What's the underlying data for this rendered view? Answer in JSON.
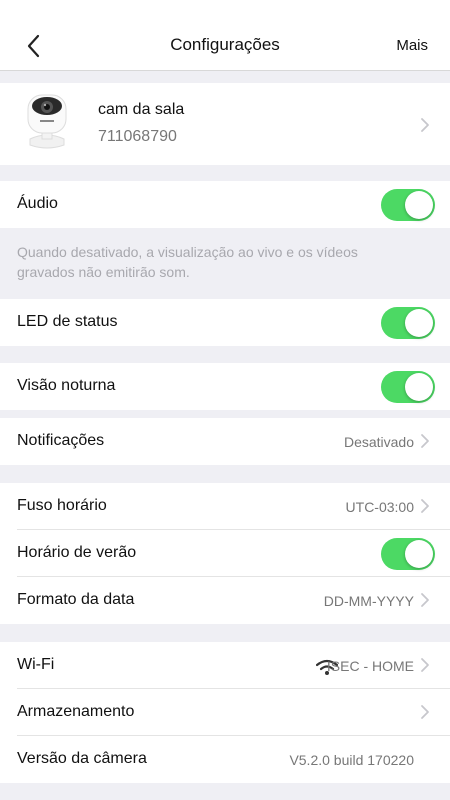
{
  "nav": {
    "title": "Configurações",
    "more_label": "Mais",
    "back_icon": "chevron-left-icon"
  },
  "device": {
    "name": "cam da sala",
    "serial": "711068790",
    "icon": "camera-icon"
  },
  "audio": {
    "label": "Áudio",
    "enabled": true,
    "note": "Quando desativado, a visualização ao vivo e os vídeos gravados não emitirão som."
  },
  "led": {
    "label": "LED de status",
    "enabled": true
  },
  "night_vision": {
    "label": "Visão noturna",
    "enabled": true
  },
  "notifications": {
    "label": "Notificações",
    "value": "Desativado"
  },
  "time": {
    "timezone_label": "Fuso horário",
    "timezone_value": "UTC-03:00",
    "dst_label": "Horário de verão",
    "dst_enabled": true,
    "date_format_label": "Formato da data",
    "date_format_value": "DD-MM-YYYY"
  },
  "network": {
    "wifi_label": "Wi-Fi",
    "wifi_value": "ISEC - HOME",
    "wifi_icon": "wifi-icon",
    "storage_label": "Armazenamento",
    "version_label": "Versão da câmera",
    "version_value": "V5.2.0 build 170220"
  },
  "colors": {
    "toggle_on": "#4cd964",
    "background": "#efeff4",
    "secondary_text": "#777777"
  }
}
